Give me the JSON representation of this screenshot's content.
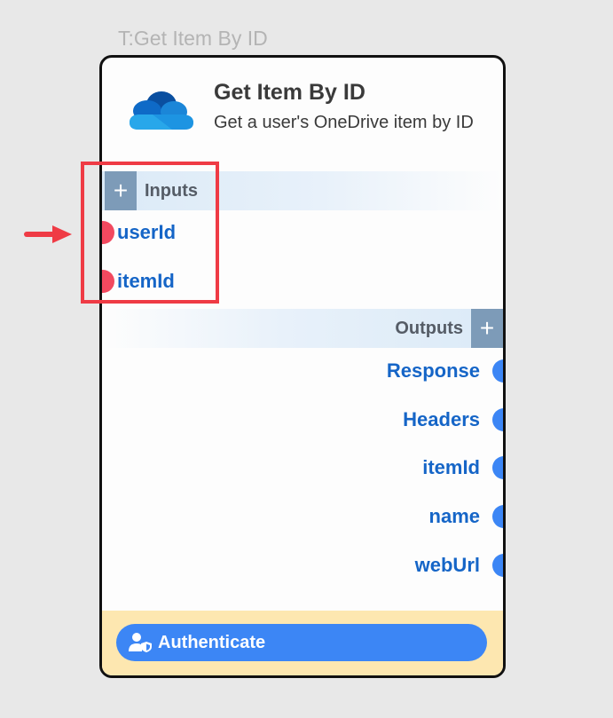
{
  "node_caption": "T:Get Item By ID",
  "node": {
    "title": "Get Item By ID",
    "description": "Get a user's OneDrive item by ID",
    "logo_icon": "onedrive-cloud-icon"
  },
  "inputs": {
    "label": "Inputs",
    "add_icon": "plus-icon",
    "ports": [
      {
        "label": "userId"
      },
      {
        "label": "itemId"
      }
    ]
  },
  "outputs": {
    "label": "Outputs",
    "add_icon": "plus-icon",
    "ports": [
      {
        "label": "Response"
      },
      {
        "label": "Headers"
      },
      {
        "label": "itemId"
      },
      {
        "label": "name"
      },
      {
        "label": "webUrl"
      }
    ]
  },
  "footer": {
    "auth_button_label": "Authenticate",
    "auth_icon": "user-shield-icon"
  },
  "colors": {
    "canvas_background": "#e8e8e8",
    "node_border": "#111111",
    "input_port": "#f2495f",
    "output_port": "#3c86f5",
    "port_label": "#1565c7",
    "section_button": "#7d9bb8",
    "footer_background": "#fde7b0",
    "auth_button": "#3c86f5",
    "highlight_box": "#ef3b45",
    "annotation_arrow": "#ef3b45"
  }
}
